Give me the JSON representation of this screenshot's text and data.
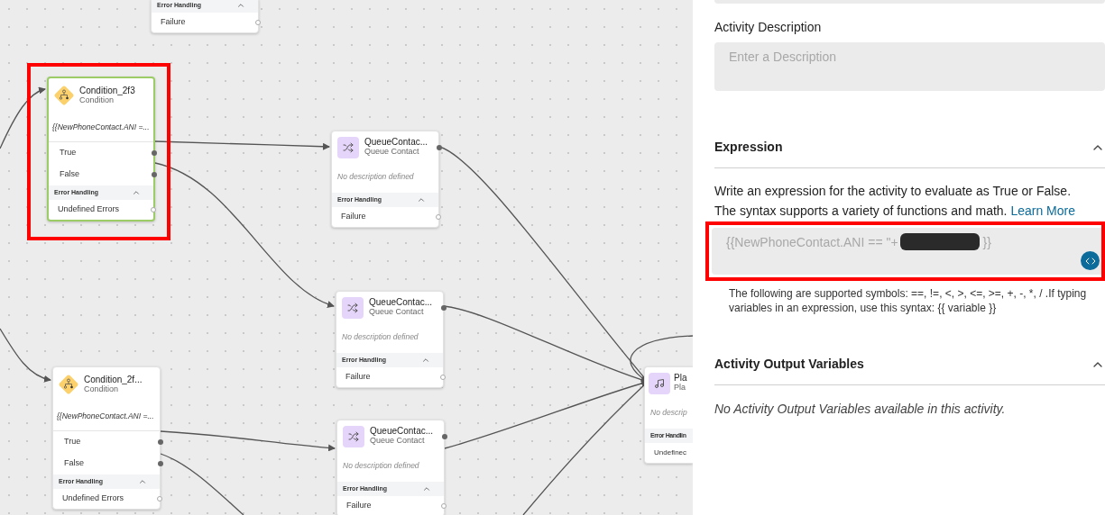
{
  "canvas": {
    "nodes": [
      {
        "kind": "partial",
        "selected": false,
        "error_heading": "Error Handling",
        "error_expanded": true,
        "error_output": "Failure"
      },
      {
        "kind": "condition",
        "selected": true,
        "title": "Condition_2f3",
        "subtitle": "Condition",
        "expression": "{{NewPhoneContact.ANI =...",
        "outputs": [
          "True",
          "False"
        ],
        "error_heading": "Error Handling",
        "error_expanded": true,
        "error_output": "Undefined Errors"
      },
      {
        "kind": "queue",
        "selected": false,
        "title": "QueueContac...",
        "subtitle": "Queue Contact",
        "description": "No description defined",
        "error_heading": "Error Handling",
        "error_expanded": true,
        "error_output": "Failure"
      },
      {
        "kind": "queue",
        "selected": false,
        "title": "QueueContac...",
        "subtitle": "Queue Contact",
        "description": "No description defined",
        "error_heading": "Error Handling",
        "error_expanded": true,
        "error_output": "Failure"
      },
      {
        "kind": "condition",
        "selected": false,
        "title": "Condition_2f...",
        "subtitle": "Condition",
        "expression": "{{NewPhoneContact.ANI =...",
        "outputs": [
          "True",
          "False"
        ],
        "error_heading": "Error Handling",
        "error_expanded": true,
        "error_output": "Undefined Errors"
      },
      {
        "kind": "queue",
        "selected": false,
        "title": "QueueContac...",
        "subtitle": "Queue Contact",
        "description": "No description defined",
        "error_heading": "Error Handling",
        "error_expanded": true,
        "error_output": "Failure"
      },
      {
        "kind": "play",
        "selected": false,
        "title": "Pla",
        "subtitle": "Pla",
        "description": "No descrip",
        "error_heading": "Error Handlin",
        "error_output": "Undefinec"
      }
    ]
  },
  "panel": {
    "description_label": "Activity Description",
    "description_placeholder": "Enter a Description",
    "expression_section": {
      "title": "Expression",
      "expanded": true,
      "intro": "Write an expression for the activity to evaluate as True or False.",
      "syntax_text": "The syntax supports a variety of functions and math.",
      "learn_more": "Learn More",
      "value_before": "{{NewPhoneContact.ANI == \"+",
      "value_after": "}}",
      "help_lines": [
        "The following are supported symbols: ==, !=, <, >, <=, >=, +, -, *, / .If typing",
        "variables in an expression, use this syntax: {{ variable }}"
      ]
    },
    "output_section": {
      "title": "Activity Output Variables",
      "expanded": true,
      "empty_text": "No Activity Output Variables available in this activity."
    }
  }
}
